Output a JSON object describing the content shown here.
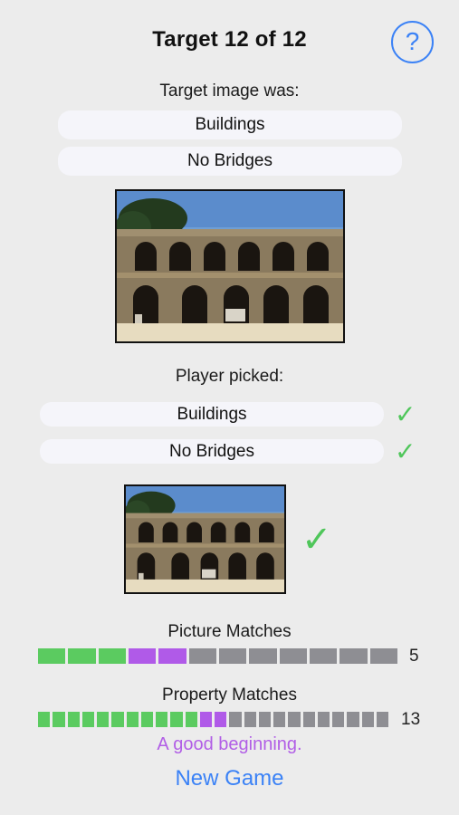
{
  "header": {
    "title": "Target 12 of 12",
    "help_glyph": "?"
  },
  "target": {
    "heading": "Target image was:",
    "properties": [
      "Buildings",
      "No Bridges"
    ],
    "image_desc": "courtyard-arcade-photo"
  },
  "player": {
    "heading": "Player picked:",
    "properties": [
      "Buildings",
      "No Bridges"
    ],
    "property_results": [
      "correct",
      "correct"
    ],
    "image_result": "correct"
  },
  "picture_matches": {
    "label": "Picture Matches",
    "count": "5",
    "segments": [
      "green",
      "green",
      "green",
      "purple",
      "purple",
      "gray",
      "gray",
      "gray",
      "gray",
      "gray",
      "gray",
      "gray"
    ]
  },
  "property_matches": {
    "label": "Property Matches",
    "count": "13",
    "segments": [
      "green",
      "green",
      "green",
      "green",
      "green",
      "green",
      "green",
      "green",
      "green",
      "green",
      "green",
      "purple",
      "purple",
      "gray",
      "gray",
      "gray",
      "gray",
      "gray",
      "gray",
      "gray",
      "gray",
      "gray",
      "gray",
      "gray"
    ]
  },
  "message": "A good beginning.",
  "new_game_label": "New Game",
  "colors": {
    "green": "#5bcb60",
    "purple": "#b05ae8",
    "gray": "#8e8e93",
    "accent": "#3b82f6",
    "check": "#4fc65a"
  },
  "icons": {
    "check": "checkmark-icon",
    "help": "question-circle-icon"
  }
}
